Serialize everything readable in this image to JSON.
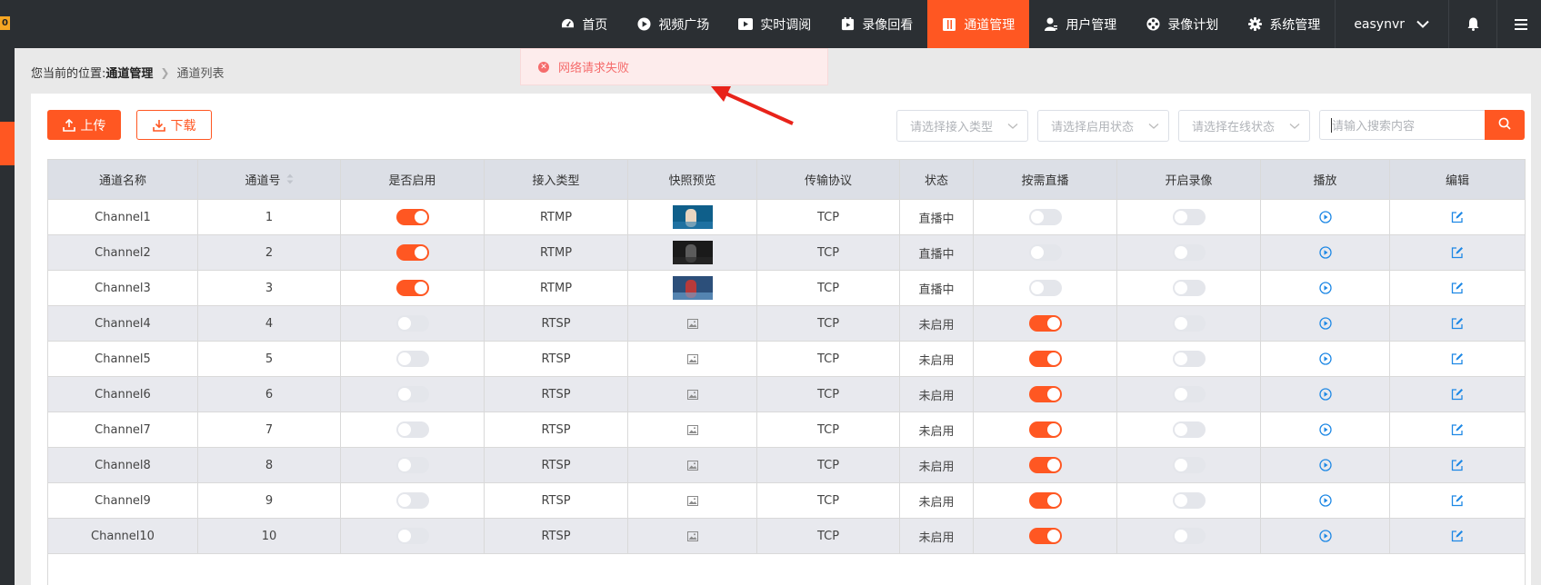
{
  "nav": {
    "logo_fragment": "0",
    "items": [
      {
        "label": "首页",
        "icon": "dashboard-icon"
      },
      {
        "label": "视频广场",
        "icon": "play-circle-icon"
      },
      {
        "label": "实时调阅",
        "icon": "video-icon"
      },
      {
        "label": "录像回看",
        "icon": "calendar-play-icon"
      },
      {
        "label": "通道管理",
        "icon": "columns-icon",
        "active": true
      },
      {
        "label": "用户管理",
        "icon": "user-icon"
      },
      {
        "label": "录像计划",
        "icon": "film-reel-icon"
      },
      {
        "label": "系统管理",
        "icon": "gear-icon"
      }
    ],
    "username": "easynvr"
  },
  "breadcrumb": {
    "prefix": "您当前的位置:",
    "current": "通道管理",
    "last": "通道列表"
  },
  "toast": {
    "message": "网络请求失败",
    "type": "error"
  },
  "toolbar": {
    "upload_label": "上传",
    "download_label": "下载",
    "filter_access_type_placeholder": "请选择接入类型",
    "filter_enable_state_placeholder": "请选择启用状态",
    "filter_online_state_placeholder": "请选择在线状态",
    "search_placeholder": "请输入搜索内容"
  },
  "table": {
    "headers": [
      "通道名称",
      "通道号",
      "是否启用",
      "接入类型",
      "快照预览",
      "传输协议",
      "状态",
      "按需直播",
      "开启录像",
      "播放",
      "编辑"
    ],
    "rows": [
      {
        "name": "Channel1",
        "number": "1",
        "enabled": true,
        "access_type": "RTMP",
        "snapshot": "image",
        "protocol": "TCP",
        "status": "直播中",
        "on_demand": false,
        "record": false
      },
      {
        "name": "Channel2",
        "number": "2",
        "enabled": true,
        "access_type": "RTMP",
        "snapshot": "image",
        "protocol": "TCP",
        "status": "直播中",
        "on_demand": false,
        "record": false
      },
      {
        "name": "Channel3",
        "number": "3",
        "enabled": true,
        "access_type": "RTMP",
        "snapshot": "image",
        "protocol": "TCP",
        "status": "直播中",
        "on_demand": false,
        "record": false
      },
      {
        "name": "Channel4",
        "number": "4",
        "enabled": false,
        "access_type": "RTSP",
        "snapshot": "placeholder",
        "protocol": "TCP",
        "status": "未启用",
        "on_demand": true,
        "record": false
      },
      {
        "name": "Channel5",
        "number": "5",
        "enabled": false,
        "access_type": "RTSP",
        "snapshot": "placeholder",
        "protocol": "TCP",
        "status": "未启用",
        "on_demand": true,
        "record": false
      },
      {
        "name": "Channel6",
        "number": "6",
        "enabled": false,
        "access_type": "RTSP",
        "snapshot": "placeholder",
        "protocol": "TCP",
        "status": "未启用",
        "on_demand": true,
        "record": false
      },
      {
        "name": "Channel7",
        "number": "7",
        "enabled": false,
        "access_type": "RTSP",
        "snapshot": "placeholder",
        "protocol": "TCP",
        "status": "未启用",
        "on_demand": true,
        "record": false
      },
      {
        "name": "Channel8",
        "number": "8",
        "enabled": false,
        "access_type": "RTSP",
        "snapshot": "placeholder",
        "protocol": "TCP",
        "status": "未启用",
        "on_demand": true,
        "record": false
      },
      {
        "name": "Channel9",
        "number": "9",
        "enabled": false,
        "access_type": "RTSP",
        "snapshot": "placeholder",
        "protocol": "TCP",
        "status": "未启用",
        "on_demand": true,
        "record": false
      },
      {
        "name": "Channel10",
        "number": "10",
        "enabled": false,
        "access_type": "RTSP",
        "snapshot": "placeholder",
        "protocol": "TCP",
        "status": "未启用",
        "on_demand": true,
        "record": false
      }
    ]
  },
  "colors": {
    "accent": "#ff5722",
    "nav_bg": "#2b2f33",
    "status_live": "#1ea01e",
    "status_off": "#e61e1e",
    "error": "#f56c6c",
    "link": "#1e88e5"
  }
}
